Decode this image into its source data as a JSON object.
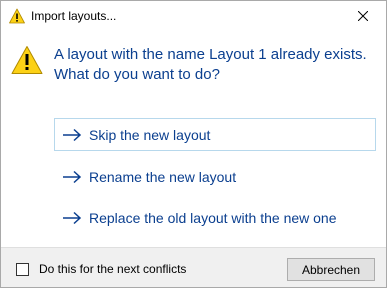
{
  "window": {
    "title": "Import layouts...",
    "title_icon": "warning-icon",
    "close_icon": "close-icon"
  },
  "message": {
    "icon": "warning-icon",
    "text": "A layout with the name Layout 1 already exists. What do you want to do?"
  },
  "commands": [
    {
      "label": "Skip the new layout",
      "icon": "arrow-right-icon",
      "focused": true
    },
    {
      "label": "Rename the new layout",
      "icon": "arrow-right-icon",
      "focused": false
    },
    {
      "label": "Replace the old layout with the new one",
      "icon": "arrow-right-icon",
      "focused": false
    }
  ],
  "footer": {
    "checkbox_label": "Do this for the next conflicts",
    "checkbox_checked": false,
    "cancel_label": "Abbrechen"
  },
  "colors": {
    "accent_text": "#0b3f8f",
    "warning_yellow": "#fcd116",
    "focus_border": "#b7d8ec",
    "footer_bg": "#f0f0f0"
  }
}
